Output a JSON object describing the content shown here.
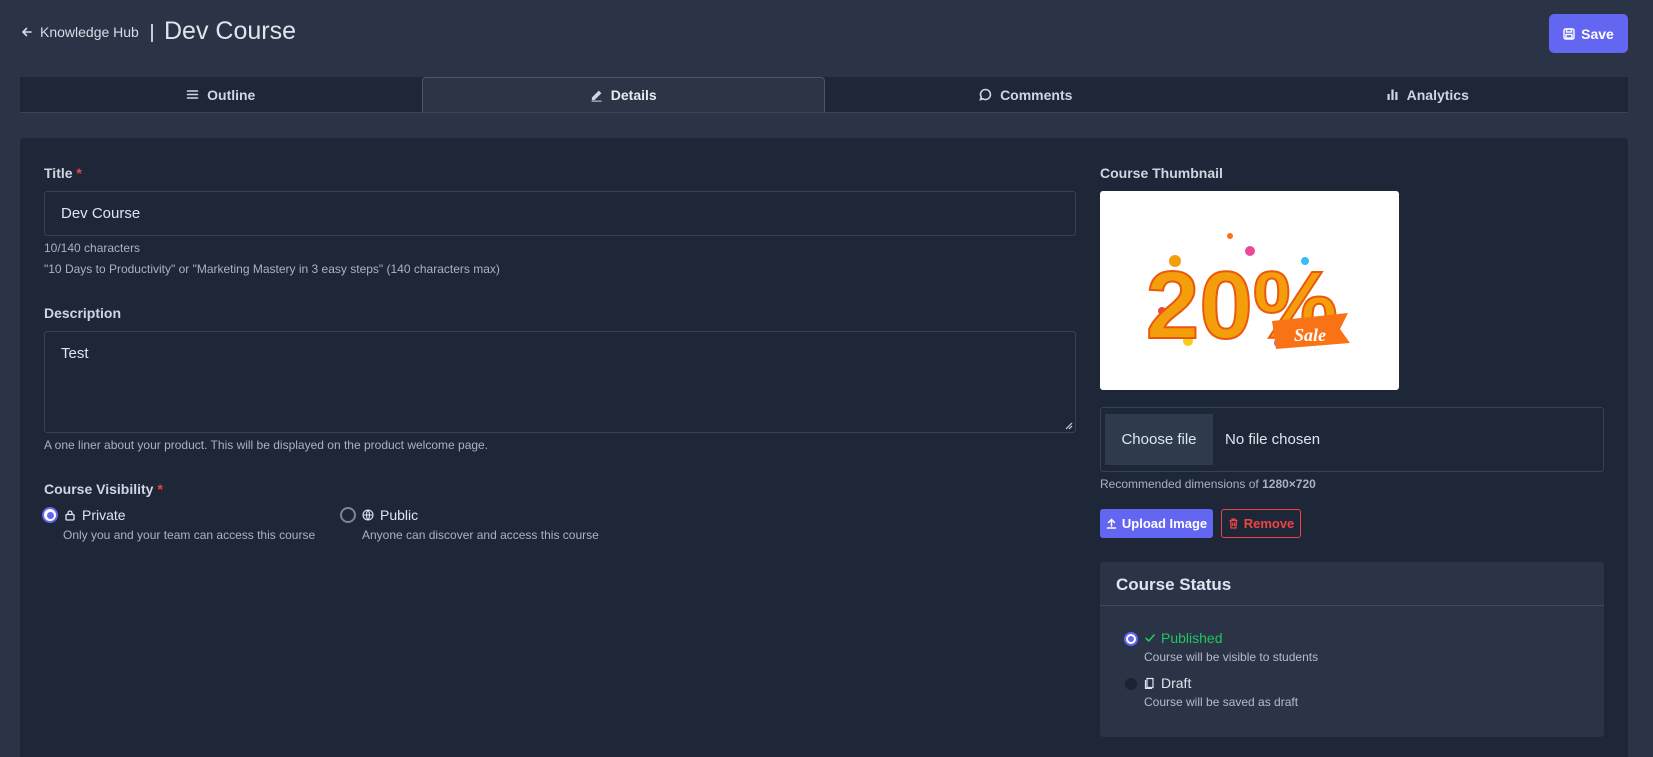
{
  "header": {
    "back_label": "Knowledge Hub",
    "title": "Dev Course",
    "save_label": "Save"
  },
  "tabs": [
    {
      "label": "Outline",
      "icon": "list-icon",
      "active": false
    },
    {
      "label": "Details",
      "icon": "pencil-icon",
      "active": true
    },
    {
      "label": "Comments",
      "icon": "chat-bubble-icon",
      "active": false
    },
    {
      "label": "Analytics",
      "icon": "bar-chart-icon",
      "active": false
    }
  ],
  "form": {
    "title_label": "Title",
    "required_mark": "*",
    "title_value": "Dev Course",
    "title_count": "10/140 characters",
    "title_hint": "\"10 Days to Productivity\" or \"Marketing Mastery in 3 easy steps\" (140 characters max)",
    "description_label": "Description",
    "description_value": "Test",
    "description_hint": "A one liner about your product. This will be displayed on the product welcome page.",
    "visibility_label": "Course Visibility",
    "visibility_options": [
      {
        "label": "Private",
        "description": "Only you and your team can access this course",
        "icon": "lock-icon",
        "selected": true
      },
      {
        "label": "Public",
        "description": "Anyone can discover and access this course",
        "icon": "globe-icon",
        "selected": false
      }
    ]
  },
  "thumbnail": {
    "label": "Course Thumbnail",
    "image_text_main": "20%",
    "image_text_sale": "Sale",
    "choose_file_label": "Choose file",
    "no_file_label": "No file chosen",
    "recommended_prefix": "Recommended dimensions of ",
    "recommended_dims": "1280×720",
    "upload_label": "Upload Image",
    "remove_label": "Remove"
  },
  "status": {
    "title": "Course Status",
    "options": [
      {
        "label": "Published",
        "description": "Course will be visible to students",
        "icon": "check-icon",
        "selected": true
      },
      {
        "label": "Draft",
        "description": "Course will be saved as draft",
        "icon": "document-icon",
        "selected": false
      }
    ]
  },
  "colors": {
    "accent": "#6366f1",
    "danger": "#ef4444",
    "success": "#22c55e",
    "background": "#2a3446",
    "panel": "#1e2738"
  }
}
